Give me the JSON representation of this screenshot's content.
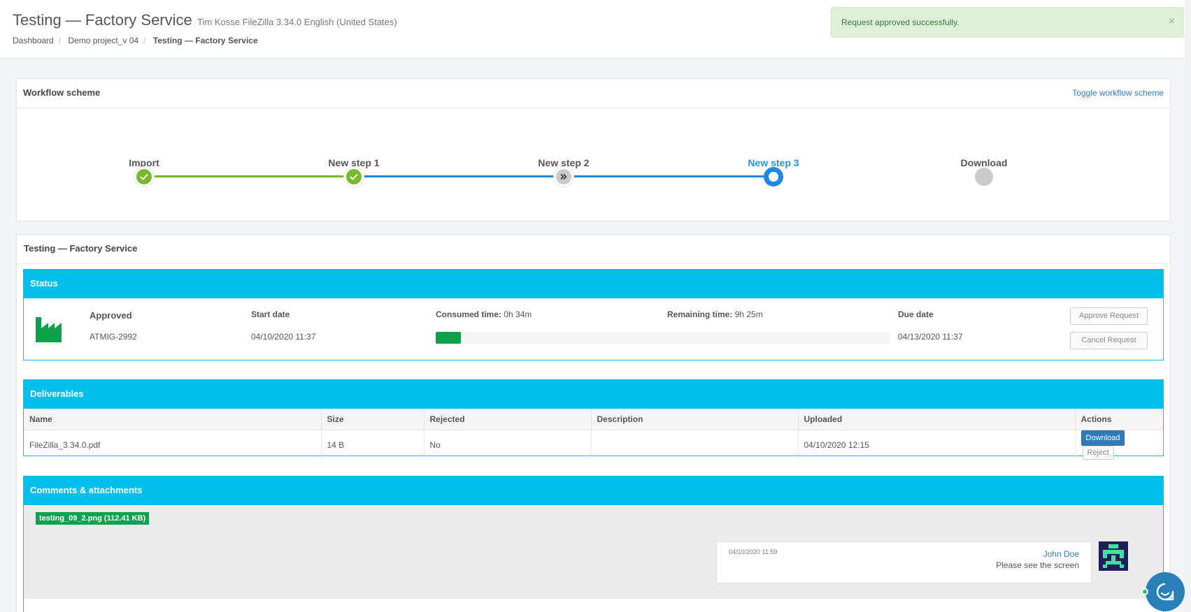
{
  "header": {
    "title": "Testing — Factory Service",
    "subtitle": "Tim Kosse FileZilla 3.34.0 English (United States)",
    "breadcrumb": [
      "Dashboard",
      "Demo project_v 04",
      "Testing — Factory Service"
    ]
  },
  "alert": {
    "message": "Request approved successfully.",
    "close_label": "×"
  },
  "workflow": {
    "title": "Workflow scheme",
    "toggle_label": "Toggle workflow scheme",
    "steps": [
      {
        "label": "Import",
        "state": "done"
      },
      {
        "label": "New step 1",
        "state": "done"
      },
      {
        "label": "New step 2",
        "state": "skipped"
      },
      {
        "label": "New step 3",
        "state": "current"
      },
      {
        "label": "Download",
        "state": "pending"
      }
    ],
    "colors": {
      "done": "#79b92e",
      "active_line": "#1e88e5",
      "pending": "#cacaca"
    }
  },
  "request": {
    "title": "Testing — Factory Service",
    "status": {
      "heading": "Status",
      "state": "Approved",
      "id": "ATMIG-2992",
      "start_date_label": "Start date",
      "start_date": "04/10/2020 11:37",
      "consumed_label": "Consumed time:",
      "consumed": "0h 34m",
      "remaining_label": "Remaining time:",
      "remaining": "9h 25m",
      "progress_percent": 5.6,
      "due_date_label": "Due date",
      "due_date": "04/13/2020 11:37",
      "approve_label": "Approve Request",
      "cancel_label": "Cancel Request"
    },
    "deliverables": {
      "heading": "Deliverables",
      "columns": [
        "Name",
        "Size",
        "Rejected",
        "Description",
        "Uploaded",
        "Actions"
      ],
      "rows": [
        {
          "name": "FileZilla_3.34.0.pdf",
          "size": "14 B",
          "rejected": "No",
          "description": "",
          "uploaded": "04/10/2020 12:15",
          "download_label": "Download",
          "reject_label": "Reject"
        }
      ]
    },
    "comments": {
      "heading": "Comments & attachments",
      "attachment": "testing_09_2.png (112.41 KB)",
      "items": [
        {
          "time": "04/10/2020 11:59",
          "author": "John Doe",
          "text": "Please see the screen"
        }
      ]
    }
  },
  "theme": {
    "accent": "#00bfec",
    "success": "#0ca24c",
    "link": "#337ab7"
  }
}
